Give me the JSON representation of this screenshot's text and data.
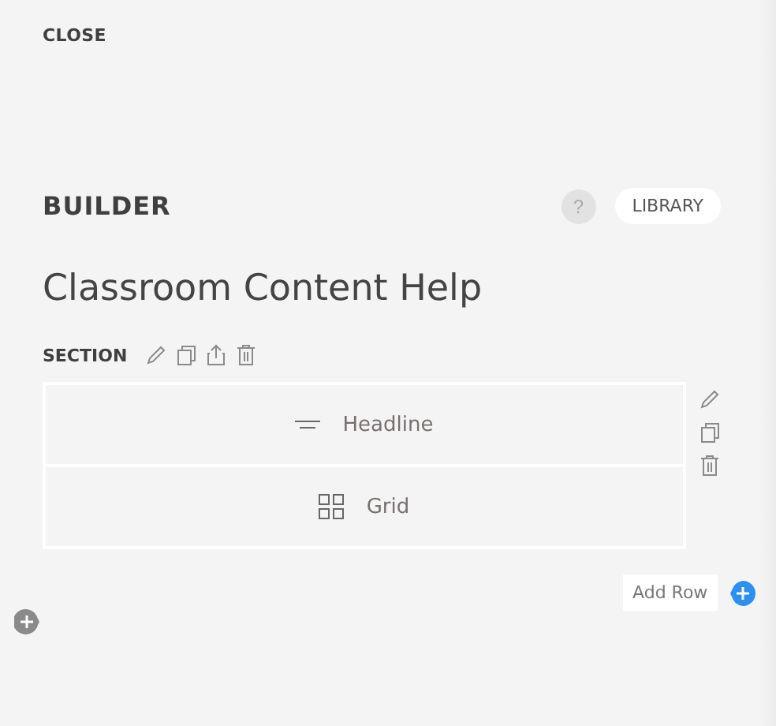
{
  "close": "CLOSE",
  "builder": {
    "title": "BUILDER",
    "help": "?",
    "library": "LIBRARY"
  },
  "page_title": "Classroom Content Help",
  "section": {
    "label": "SECTION",
    "rows": [
      {
        "kind": "headline",
        "label": "Headline"
      },
      {
        "kind": "grid",
        "label": "Grid"
      }
    ],
    "add_row": "Add Row"
  }
}
